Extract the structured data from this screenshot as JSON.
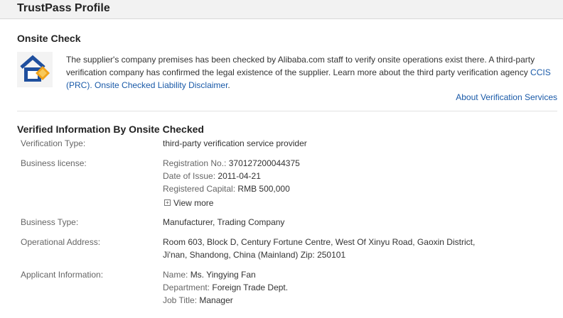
{
  "header": {
    "title": "TrustPass Profile"
  },
  "onsite": {
    "title": "Onsite Check",
    "icon": "house-check-icon",
    "text1": "The supplier's company premises has been checked by Alibaba.com staff to verify onsite operations exist there. A third-party verification company has confirmed the legal existence of the supplier. Learn more about the third party verification agency",
    "agency_link": "CCIS (PRC).",
    "disclaimer_link": "Onsite Checked Liability Disclaimer",
    "period": ".",
    "about_link": "About Verification Services"
  },
  "verified": {
    "title": "Verified Information By Onsite Checked",
    "verification_type": {
      "label": "Verification Type:",
      "value": "third-party verification service provider"
    },
    "business_license": {
      "label": "Business license:",
      "reg_no_key": "Registration No.:",
      "reg_no": "370127200044375",
      "date_key": "Date of Issue:",
      "date": "2011-04-21",
      "capital_key": "Registered Capital:",
      "capital": "RMB 500,000",
      "view_more": "View more"
    },
    "business_type": {
      "label": "Business Type:",
      "value": "Manufacturer, Trading Company"
    },
    "address": {
      "label": "Operational Address:",
      "line1": "Room 603, Block D, Century Fortune Centre, West Of Xinyu Road, Gaoxin District,",
      "line2": "Ji'nan, Shandong, China (Mainland) Zip: 250101"
    },
    "applicant": {
      "label": "Applicant Information:",
      "name_key": "Name:",
      "name": "Ms. Yingying Fan",
      "dept_key": "Department:",
      "dept": "Foreign Trade Dept.",
      "title_key": "Job Title:",
      "title": "Manager"
    }
  },
  "colors": {
    "link": "#1a5aa8",
    "header_bg": "#f2f2f2"
  }
}
